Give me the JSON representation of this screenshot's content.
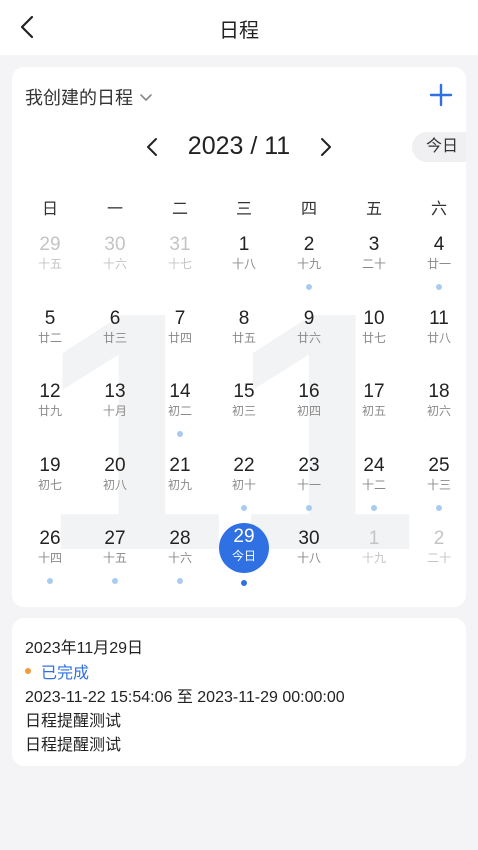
{
  "header": {
    "title": "日程",
    "back_icon": "chevron-left-icon"
  },
  "calendar": {
    "filter_label": "我创建的日程",
    "filter_icon": "chevron-down-icon",
    "add_icon": "plus-icon",
    "month_label": "2023 / 11",
    "today_label": "今日",
    "watermark": "11",
    "weekdays": [
      "日",
      "一",
      "二",
      "三",
      "四",
      "五",
      "六"
    ],
    "days": [
      {
        "num": "29",
        "lunar": "十五",
        "other": true,
        "dot": false
      },
      {
        "num": "30",
        "lunar": "十六",
        "other": true,
        "dot": false
      },
      {
        "num": "31",
        "lunar": "十七",
        "other": true,
        "dot": false
      },
      {
        "num": "1",
        "lunar": "十八",
        "other": false,
        "dot": false
      },
      {
        "num": "2",
        "lunar": "十九",
        "other": false,
        "dot": true
      },
      {
        "num": "3",
        "lunar": "二十",
        "other": false,
        "dot": false
      },
      {
        "num": "4",
        "lunar": "廿一",
        "other": false,
        "dot": true
      },
      {
        "num": "5",
        "lunar": "廿二",
        "other": false,
        "dot": false
      },
      {
        "num": "6",
        "lunar": "廿三",
        "other": false,
        "dot": false
      },
      {
        "num": "7",
        "lunar": "廿四",
        "other": false,
        "dot": false
      },
      {
        "num": "8",
        "lunar": "廿五",
        "other": false,
        "dot": false
      },
      {
        "num": "9",
        "lunar": "廿六",
        "other": false,
        "dot": false
      },
      {
        "num": "10",
        "lunar": "廿七",
        "other": false,
        "dot": false
      },
      {
        "num": "11",
        "lunar": "廿八",
        "other": false,
        "dot": false
      },
      {
        "num": "12",
        "lunar": "廿九",
        "other": false,
        "dot": false
      },
      {
        "num": "13",
        "lunar": "十月",
        "other": false,
        "dot": false
      },
      {
        "num": "14",
        "lunar": "初二",
        "other": false,
        "dot": true
      },
      {
        "num": "15",
        "lunar": "初三",
        "other": false,
        "dot": false
      },
      {
        "num": "16",
        "lunar": "初四",
        "other": false,
        "dot": false
      },
      {
        "num": "17",
        "lunar": "初五",
        "other": false,
        "dot": false
      },
      {
        "num": "18",
        "lunar": "初六",
        "other": false,
        "dot": false
      },
      {
        "num": "19",
        "lunar": "初七",
        "other": false,
        "dot": false
      },
      {
        "num": "20",
        "lunar": "初八",
        "other": false,
        "dot": false
      },
      {
        "num": "21",
        "lunar": "初九",
        "other": false,
        "dot": false
      },
      {
        "num": "22",
        "lunar": "初十",
        "other": false,
        "dot": true
      },
      {
        "num": "23",
        "lunar": "十一",
        "other": false,
        "dot": true
      },
      {
        "num": "24",
        "lunar": "十二",
        "other": false,
        "dot": true
      },
      {
        "num": "25",
        "lunar": "十三",
        "other": false,
        "dot": true
      },
      {
        "num": "26",
        "lunar": "十四",
        "other": false,
        "dot": true
      },
      {
        "num": "27",
        "lunar": "十五",
        "other": false,
        "dot": true
      },
      {
        "num": "28",
        "lunar": "十六",
        "other": false,
        "dot": true
      },
      {
        "num": "29",
        "lunar": "今日",
        "other": false,
        "dot": true,
        "selected": true
      },
      {
        "num": "30",
        "lunar": "十八",
        "other": false,
        "dot": false
      },
      {
        "num": "1",
        "lunar": "十九",
        "other": true,
        "dot": false
      },
      {
        "num": "2",
        "lunar": "二十",
        "other": true,
        "dot": false
      }
    ]
  },
  "event": {
    "date": "2023年11月29日",
    "status": "已完成",
    "range": "2023-11-22 15:54:06 至 2023-11-29 00:00:00",
    "title": "日程提醒测试",
    "description": "日程提醒测试"
  },
  "colors": {
    "accent": "#2f70e3",
    "event_dot": "#a9cbf0",
    "status_dot": "#f39a3a"
  }
}
